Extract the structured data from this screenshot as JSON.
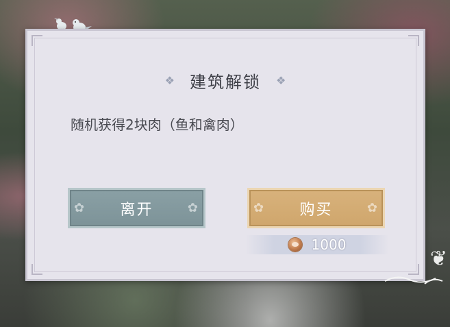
{
  "dialog": {
    "title": "建筑解锁",
    "description": "随机获得2块肉（鱼和禽肉）",
    "leave_button": "离开",
    "buy_button": "购买",
    "cost": {
      "icon": "meat-coin-icon",
      "value": "1000"
    }
  },
  "colors": {
    "dialog_bg": "#e6e4ec",
    "leave_button": "#8aa0a5",
    "buy_button": "#d8b27c"
  }
}
